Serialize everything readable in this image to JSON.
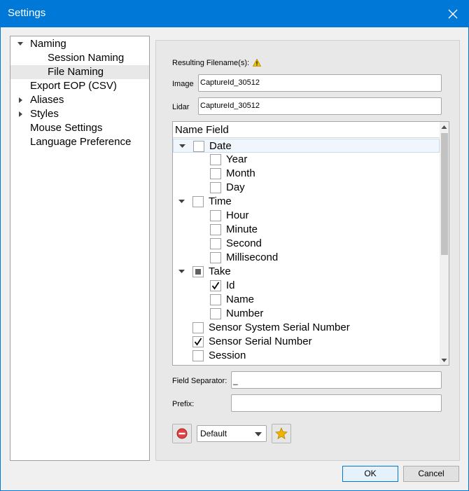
{
  "window": {
    "title": "Settings"
  },
  "nav": {
    "items": [
      {
        "label": "Naming",
        "expanded": true
      },
      {
        "label": "Session Naming"
      },
      {
        "label": "File Naming",
        "selected": true
      },
      {
        "label": "Export EOP (CSV)"
      },
      {
        "label": "Aliases",
        "expanded": false
      },
      {
        "label": "Styles",
        "expanded": false
      },
      {
        "label": "Mouse Settings"
      },
      {
        "label": "Language Preference"
      }
    ]
  },
  "panel": {
    "resulting_label": "Resulting Filename(s):",
    "warning_icon": "warning-icon",
    "image_label": "Image",
    "image_value": "CaptureId_30512",
    "lidar_label": "Lidar",
    "lidar_value": "CaptureId_30512",
    "tree_header": "Name Field",
    "tree_rows": [
      {
        "label": "Date",
        "state": "unchecked",
        "group": true
      },
      {
        "label": "Year",
        "state": "unchecked"
      },
      {
        "label": "Month",
        "state": "unchecked"
      },
      {
        "label": "Day",
        "state": "unchecked"
      },
      {
        "label": "Time",
        "state": "unchecked",
        "group": true
      },
      {
        "label": "Hour",
        "state": "unchecked"
      },
      {
        "label": "Minute",
        "state": "unchecked"
      },
      {
        "label": "Second",
        "state": "unchecked"
      },
      {
        "label": "Millisecond",
        "state": "unchecked"
      },
      {
        "label": "Take",
        "state": "partial",
        "group": true
      },
      {
        "label": "Id",
        "state": "checked"
      },
      {
        "label": "Name",
        "state": "unchecked"
      },
      {
        "label": "Number",
        "state": "unchecked"
      },
      {
        "label": "Sensor System Serial Number",
        "state": "unchecked"
      },
      {
        "label": "Sensor Serial Number",
        "state": "checked"
      },
      {
        "label": "Session",
        "state": "unchecked"
      }
    ],
    "separator_label": "Field Separator:",
    "separator_value": "_",
    "prefix_label": "Prefix:",
    "prefix_value": "",
    "preset_value": "Default",
    "remove_icon": "remove-icon",
    "favorite_icon": "star-icon"
  },
  "buttons": {
    "ok": "OK",
    "cancel": "Cancel"
  },
  "colors": {
    "titlebar": "#0078d7",
    "selection": "#e8e8e8",
    "warning": "#f5c400",
    "remove": "#e04343",
    "star": "#f0b400"
  }
}
